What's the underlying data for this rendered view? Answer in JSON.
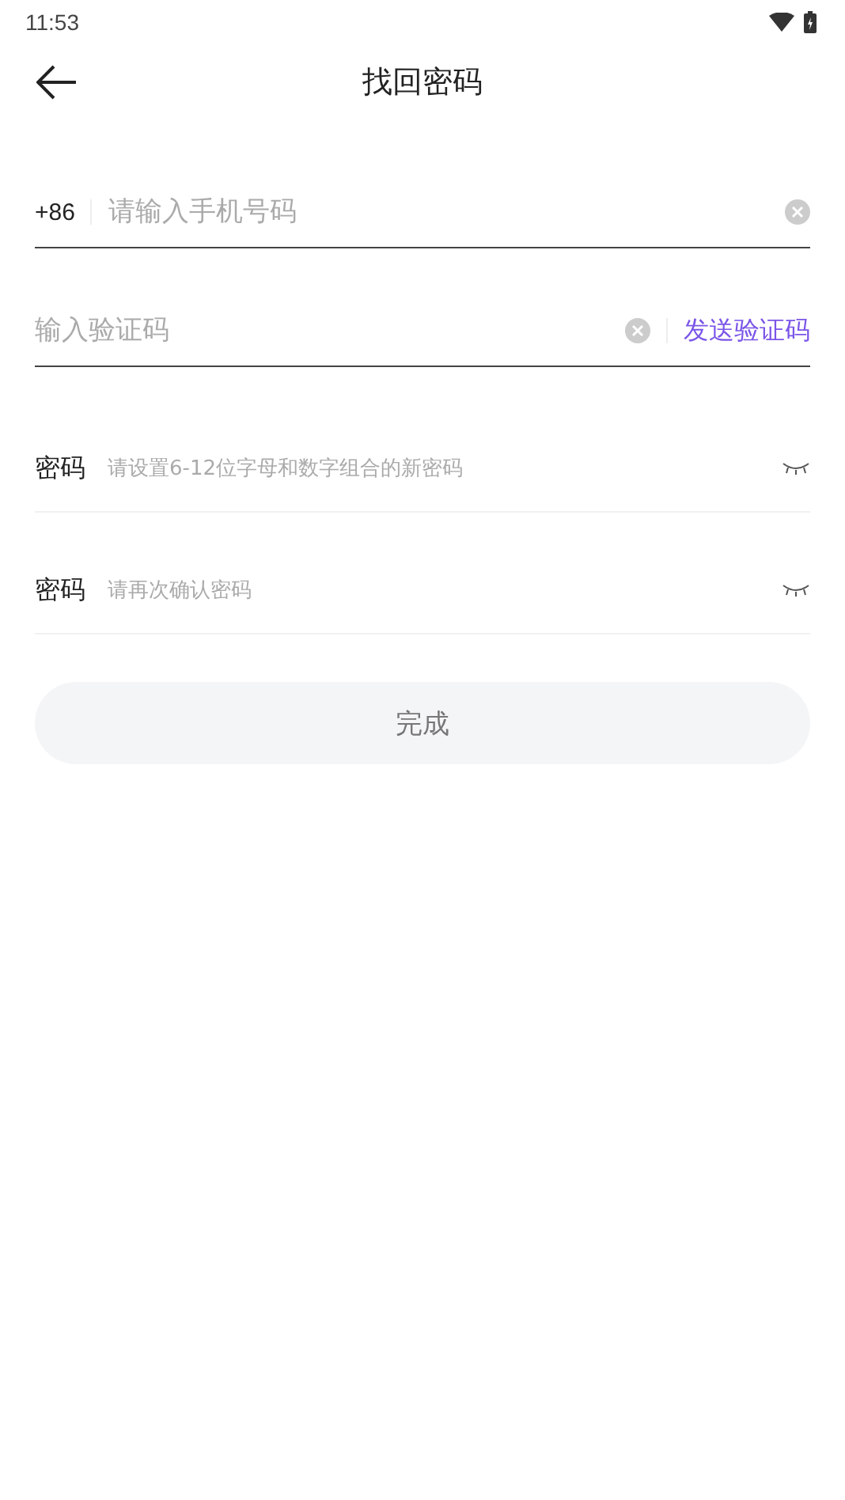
{
  "status_bar": {
    "time": "11:53"
  },
  "header": {
    "title": "找回密码"
  },
  "phone_field": {
    "prefix": "+86",
    "placeholder": "请输入手机号码"
  },
  "code_field": {
    "placeholder": "输入验证码",
    "send_link": "发送验证码"
  },
  "password_fields": [
    {
      "label": "密码",
      "placeholder": "请设置6-12位字母和数字组合的新密码"
    },
    {
      "label": "密码",
      "placeholder": "请再次确认密码"
    }
  ],
  "submit_button": {
    "label": "完成",
    "disabled": true
  }
}
